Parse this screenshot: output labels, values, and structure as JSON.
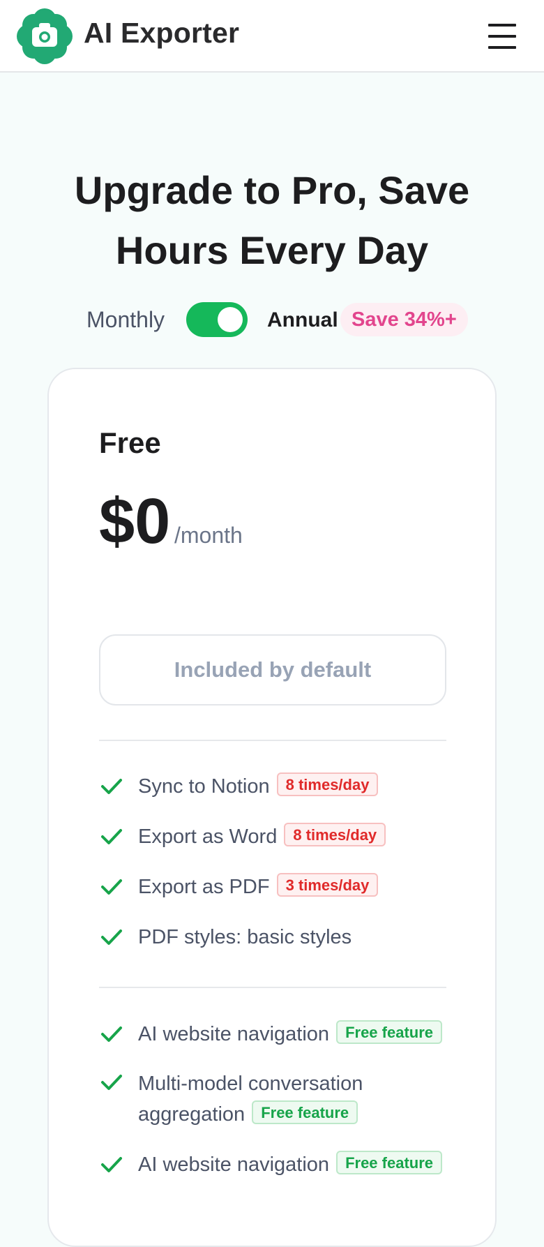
{
  "header": {
    "brand": "AI Exporter",
    "logo_icon": "camera-logo-icon",
    "menu_icon": "hamburger-menu-icon"
  },
  "hero": {
    "title_line1": "Upgrade to Pro, Save",
    "title_line2": "Hours Every Day"
  },
  "billing": {
    "monthly_label": "Monthly",
    "annual_label": "Annual",
    "toggle_state": "annual",
    "save_badge": "Save 34%+"
  },
  "plan": {
    "name": "Free",
    "price": "$0",
    "period": "/month",
    "button_label": "Included by default",
    "usage_features": [
      {
        "label": "Sync to Notion",
        "badge": "8 times/day"
      },
      {
        "label": "Export as Word",
        "badge": "8 times/day"
      },
      {
        "label": "Export as PDF",
        "badge": "3 times/day"
      },
      {
        "label": "PDF styles: basic styles",
        "badge": ""
      }
    ],
    "free_features": [
      {
        "label": "AI website navigation",
        "badge": "Free feature"
      },
      {
        "label": "Multi-model conversation aggregation",
        "badge": "Free feature"
      },
      {
        "label": "AI website navigation",
        "badge": "Free feature"
      }
    ]
  },
  "colors": {
    "accent_green": "#15b85a",
    "logo_green": "#22a974",
    "save_pink": "#e2458d",
    "limit_red": "#e02a2a"
  }
}
